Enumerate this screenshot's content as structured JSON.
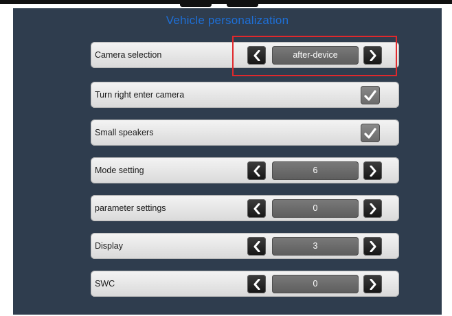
{
  "page": {
    "title": "Vehicle personalization"
  },
  "settings": [
    {
      "label": "Camera selection",
      "control": "stepper",
      "value": "after-device",
      "highlighted": true
    },
    {
      "label": "Turn right enter camera",
      "control": "checkbox",
      "checked": true
    },
    {
      "label": "Small speakers",
      "control": "checkbox",
      "checked": true
    },
    {
      "label": "Mode setting",
      "control": "stepper",
      "value": "6"
    },
    {
      "label": "parameter settings",
      "control": "stepper",
      "value": "0"
    },
    {
      "label": "Display",
      "control": "stepper",
      "value": "3"
    },
    {
      "label": "SWC",
      "control": "stepper",
      "value": "0"
    }
  ],
  "icons": {
    "previous": "chevron-left-icon",
    "next": "chevron-right-icon",
    "checked": "checkmark-icon"
  },
  "colors": {
    "background": "#2f3d4e",
    "title": "#1e6fd6",
    "highlight": "#e0282c"
  }
}
